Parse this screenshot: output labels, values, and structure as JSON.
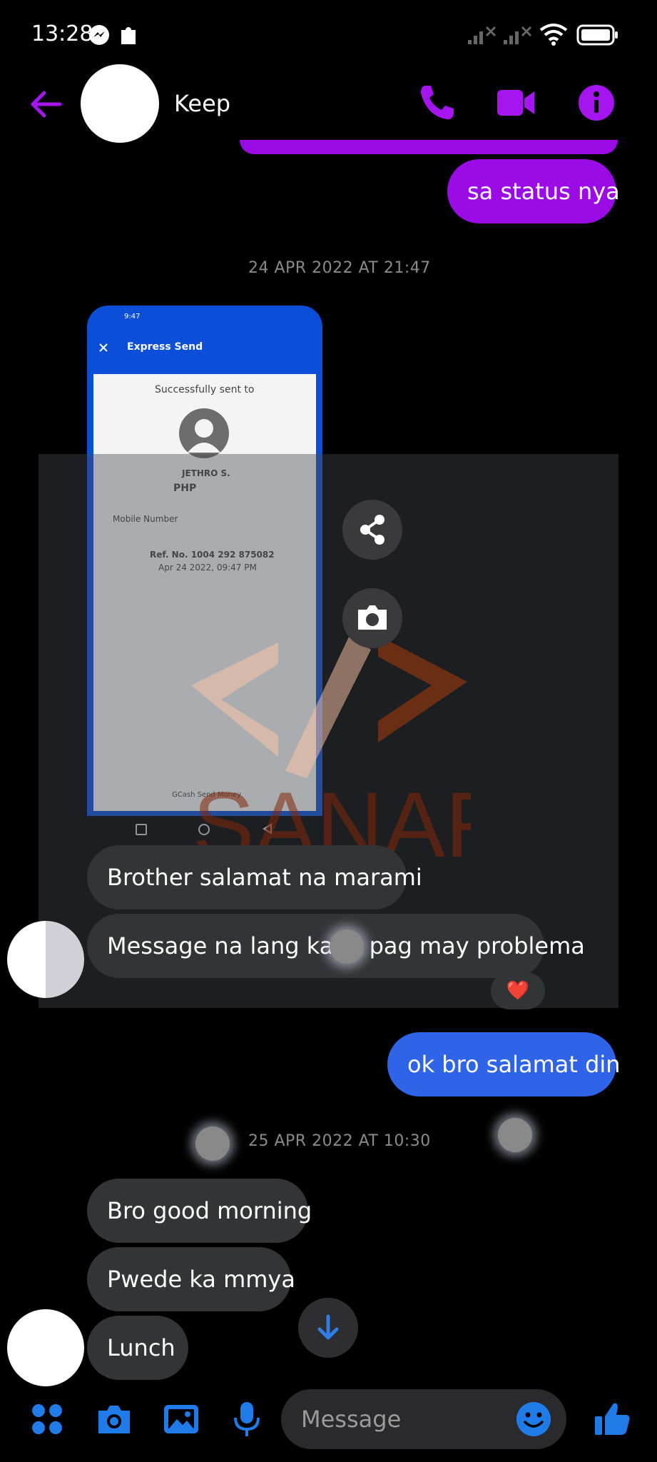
{
  "status_bar": {
    "time": "13:28"
  },
  "header": {
    "contact_name": "Keep"
  },
  "colors": {
    "accent": "#9a0be6",
    "blue": "#2f64e8",
    "bubble_in": "#333436"
  },
  "messages": {
    "out_1": "sa status nya",
    "timestamp_1": "24 APR 2022 AT 21:47",
    "in_1": "Brother salamat na marami",
    "in_2": "Message na lang kami pag may problema",
    "reaction": "❤️",
    "out_2": "ok bro salamat din",
    "timestamp_2": "25 APR 2022 AT 10:30",
    "in_3": "Bro good morning",
    "in_4": "Pwede ka mmya",
    "in_5": "Lunch"
  },
  "screenshot": {
    "time": "9:47",
    "title": "Express Send",
    "sent_to": "Successfully sent to",
    "recipient": "JETHRO S.",
    "currency": "PHP",
    "mobile_label": "Mobile Number",
    "ref": "Ref. No. 1004 292 875082",
    "date": "Apr 24 2022, 09:47 PM",
    "footer": "GCash Send Money"
  },
  "watermark": "SANARA",
  "composer": {
    "placeholder": "Message"
  },
  "icons": [
    "messenger-icon",
    "extension-icon",
    "signal-icon",
    "wifi-icon",
    "battery-icon",
    "back-arrow-icon",
    "phone-icon",
    "video-icon",
    "info-icon",
    "share-icon",
    "camera-icon",
    "scroll-down-icon",
    "apps-icon",
    "camera-icon",
    "gallery-icon",
    "microphone-icon",
    "emoji-icon",
    "thumbs-up-icon"
  ]
}
